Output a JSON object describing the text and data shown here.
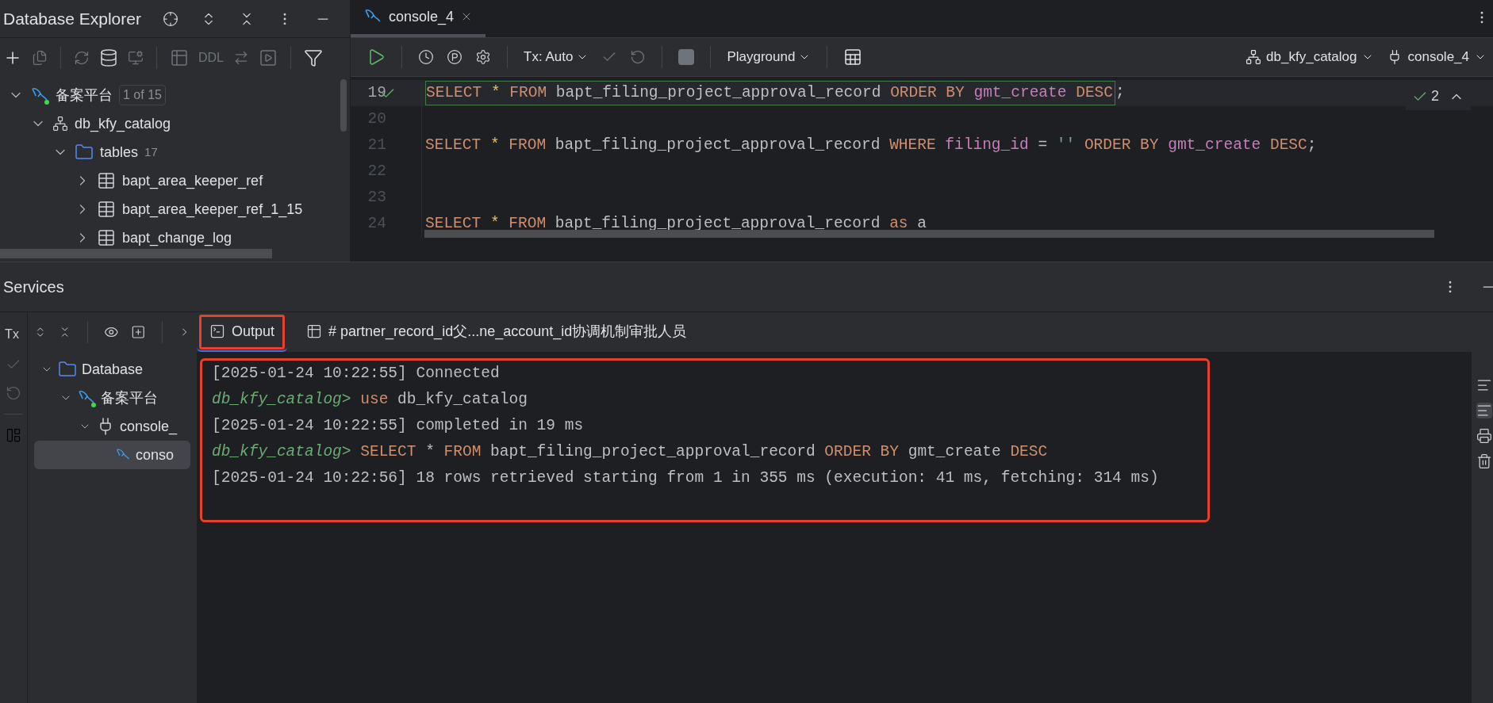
{
  "database_explorer": {
    "title": "Database Explorer",
    "toolbar_text": "DDL",
    "tree": [
      {
        "label": "备案平台",
        "badge": "1 of 15",
        "kind": "datasource",
        "expanded": true,
        "children": [
          {
            "label": "db_kfy_catalog",
            "kind": "schema",
            "expanded": true,
            "children": [
              {
                "label": "tables",
                "count": "17",
                "kind": "folder",
                "expanded": true,
                "children": [
                  {
                    "label": "bapt_area_keeper_ref",
                    "kind": "table",
                    "expanded": false
                  },
                  {
                    "label": "bapt_area_keeper_ref_1_15",
                    "kind": "table",
                    "expanded": false
                  },
                  {
                    "label": "bapt_change_log",
                    "kind": "table",
                    "expanded": false
                  }
                ]
              }
            ]
          }
        ]
      }
    ]
  },
  "editor": {
    "tabs": [
      {
        "label": "console_4",
        "selected": true
      }
    ],
    "toolbar": {
      "tx_mode": "Tx: Auto",
      "mode": "Playground",
      "schema": "db_kfy_catalog",
      "session": "console_4"
    },
    "inspection_count": "2",
    "lines": [
      {
        "number": "19",
        "executed": true,
        "tokens": [
          {
            "kind": "kw",
            "text": "SELECT"
          },
          {
            "kind": "star",
            "text": "*"
          },
          {
            "kind": "kw",
            "text": "FROM"
          },
          {
            "kind": "ident",
            "text": "bapt_filing_project_approval_record"
          },
          {
            "kind": "kw",
            "text": "ORDER BY"
          },
          {
            "kind": "col",
            "text": "gmt_create"
          },
          {
            "kind": "kw",
            "text": "DESC"
          }
        ],
        "suffix": ";"
      },
      {
        "number": "20",
        "executed": false
      },
      {
        "number": "21",
        "executed": false,
        "tokens": [
          {
            "kind": "kw",
            "text": "SELECT"
          },
          {
            "kind": "star",
            "text": "*"
          },
          {
            "kind": "kw",
            "text": "FROM"
          },
          {
            "kind": "ident",
            "text": "bapt_filing_project_approval_record"
          },
          {
            "kind": "kw",
            "text": "WHERE"
          },
          {
            "kind": "col",
            "text": "filing_id"
          },
          {
            "kind": "ident",
            "text": "="
          },
          {
            "kind": "str",
            "text": "''"
          },
          {
            "kind": "kw",
            "text": "ORDER BY"
          },
          {
            "kind": "col",
            "text": "gmt_create"
          },
          {
            "kind": "kw",
            "text": "DESC"
          }
        ],
        "suffix": ";"
      },
      {
        "number": "22",
        "executed": false
      },
      {
        "number": "23",
        "executed": false
      },
      {
        "number": "24",
        "executed": false,
        "tokens": [
          {
            "kind": "kw",
            "text": "SELECT"
          },
          {
            "kind": "star",
            "text": "*"
          },
          {
            "kind": "kw",
            "text": "FROM"
          },
          {
            "kind": "ident",
            "text": "bapt_filing_project_approval_record"
          },
          {
            "kind": "kw",
            "text": "as"
          },
          {
            "kind": "ident",
            "text": "a"
          }
        ]
      }
    ]
  },
  "services": {
    "title": "Services",
    "tx_label": "Tx",
    "tree": [
      {
        "label": "Database",
        "kind": "folder",
        "expanded": true,
        "selected": false,
        "children": [
          {
            "label": "备案平台",
            "kind": "datasource",
            "expanded": true,
            "selected": false,
            "children": [
              {
                "label": "console_",
                "kind": "session",
                "expanded": true,
                "selected": false,
                "children": [
                  {
                    "label": "conso",
                    "kind": "console",
                    "selected": true
                  }
                ]
              }
            ]
          }
        ]
      }
    ],
    "tabs": [
      {
        "label": "Output",
        "kind": "output",
        "selected": true,
        "highlighted": true
      },
      {
        "label": "# partner_record_id父...ne_account_id协调机制审批人员",
        "kind": "table",
        "selected": false,
        "highlighted": false
      }
    ],
    "output_highlighted": true,
    "output": [
      {
        "kind": "log",
        "timestamp": "[2025-01-24 10:22:55]",
        "message": "Connected"
      },
      {
        "kind": "prompt",
        "prompt": "db_kfy_catalog>",
        "tokens": [
          {
            "kind": "kw",
            "text": "use"
          },
          {
            "kind": "ident",
            "text": "db_kfy_catalog"
          }
        ]
      },
      {
        "kind": "log",
        "timestamp": "[2025-01-24 10:22:55]",
        "message": "completed in 19 ms"
      },
      {
        "kind": "prompt",
        "prompt": "db_kfy_catalog>",
        "tokens": [
          {
            "kind": "kw",
            "text": "SELECT"
          },
          {
            "kind": "ident",
            "text": "*"
          },
          {
            "kind": "kw",
            "text": "FROM"
          },
          {
            "kind": "ident",
            "text": "bapt_filing_project_approval_record"
          },
          {
            "kind": "kw",
            "text": "ORDER BY"
          },
          {
            "kind": "ident",
            "text": "gmt_create"
          },
          {
            "kind": "kw",
            "text": "DESC"
          }
        ]
      },
      {
        "kind": "log",
        "timestamp": "[2025-01-24 10:22:56]",
        "message": "18 rows retrieved starting from 1 in 355 ms (execution: 41 ms, fetching: 314 ms)"
      }
    ]
  }
}
